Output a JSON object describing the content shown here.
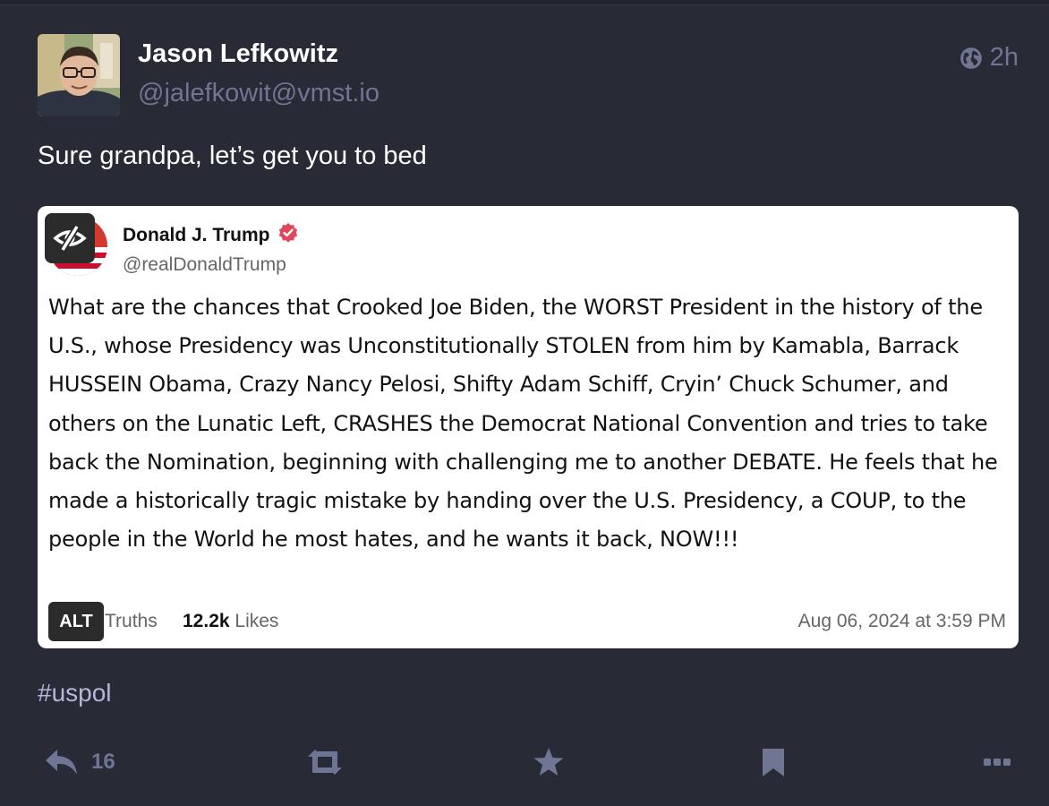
{
  "post": {
    "author_name": "Jason Lefkowitz",
    "author_handle": "@jalefkowit@vmst.io",
    "time_ago": "2h",
    "text": "Sure grandpa, let’s get you to bed",
    "hashtag": "#uspol",
    "reply_count": "16"
  },
  "quoted": {
    "author_name": "Donald J. Trump",
    "author_handle": "@realDonaldTrump",
    "body": "What are the chances that Crooked Joe Biden, the WORST President in the history of the U.S., whose Presidency was Unconstitutionally STOLEN from him by Kamabla, Barrack HUSSEIN Obama, Crazy Nancy Pelosi, Shifty Adam Schiff, Cryin’ Chuck Schumer, and others on the Lunatic Left, CRASHES the Democrat National Convention and tries to take back the Nomination, beginning with challenging me to another DEBATE. He feels that he made a historically tragic mistake by handing over the U.S. Presidency, a COUP, to the people in the World he most hates, and he wants it back, NOW!!!",
    "alt_label": "ALT",
    "truths_label": "Truths",
    "likes_count": "12.2k",
    "likes_label": "Likes",
    "date": "Aug 06, 2024 at 3:59 PM"
  },
  "icons": {
    "visibility": "globe-icon",
    "verified": "verified-badge-icon",
    "sensitive": "eye-slash-icon",
    "reply": "reply-icon",
    "boost": "boost-icon",
    "favourite": "star-icon",
    "bookmark": "bookmark-icon",
    "more": "more-icon"
  },
  "colors": {
    "background": "#282a36",
    "muted": "#6f7592",
    "hashtag": "#b3b7d8",
    "verified": "#e0475e"
  }
}
